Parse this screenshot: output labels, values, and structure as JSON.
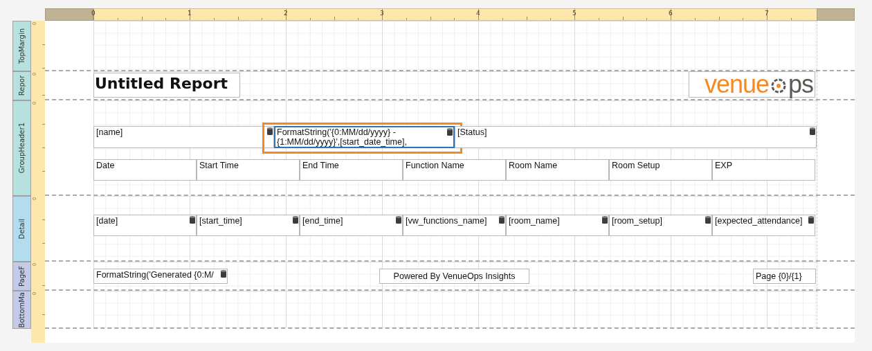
{
  "ruler": {
    "labels": [
      "0",
      "1",
      "2",
      "3",
      "4",
      "5",
      "6",
      "7"
    ]
  },
  "bands": [
    {
      "name": "TopMargin",
      "kind": "margin",
      "ruler_label": "0"
    },
    {
      "name": "Repor",
      "kind": "header",
      "ruler_label": "0",
      "controls": [
        {
          "kind": "title",
          "text": "Untitled Report",
          "bound": false,
          "selected": false
        },
        {
          "kind": "logo",
          "text_1": "venue",
          "text_2": "ps"
        }
      ]
    },
    {
      "name": "GroupHeader1",
      "kind": "header",
      "ruler_label": "0",
      "controls": [
        {
          "kind": "field",
          "text": "[name]",
          "bound": true,
          "selected": false
        },
        {
          "kind": "field",
          "text": "FormatString('{0:MM/dd/yyyy} -\n{1:MM/dd/yyyy}',[start_date_time],",
          "bound": true,
          "selected": true
        },
        {
          "kind": "field",
          "text": "[Status]",
          "bound": true,
          "selected": false
        },
        {
          "kind": "cell",
          "text": "Date",
          "bound": false,
          "selected": false
        },
        {
          "kind": "cell",
          "text": "Start Time",
          "bound": false,
          "selected": false
        },
        {
          "kind": "cell",
          "text": "End Time",
          "bound": false,
          "selected": false
        },
        {
          "kind": "cell",
          "text": "Function Name",
          "bound": false,
          "selected": false
        },
        {
          "kind": "cell",
          "text": "Room Name",
          "bound": false,
          "selected": false
        },
        {
          "kind": "cell",
          "text": "Room Setup",
          "bound": false,
          "selected": false
        },
        {
          "kind": "cell",
          "text": "EXP",
          "bound": false,
          "selected": false
        }
      ]
    },
    {
      "name": "Detail",
      "kind": "detail",
      "ruler_label": "0",
      "controls": [
        {
          "kind": "cell",
          "text": "[date]",
          "bound": true,
          "selected": false
        },
        {
          "kind": "cell",
          "text": "[start_time]",
          "bound": true,
          "selected": false
        },
        {
          "kind": "cell",
          "text": "[end_time]",
          "bound": true,
          "selected": false
        },
        {
          "kind": "cell",
          "text": "[vw_functions_name]",
          "bound": true,
          "selected": false
        },
        {
          "kind": "cell",
          "text": "[room_name]",
          "bound": true,
          "selected": false
        },
        {
          "kind": "cell",
          "text": "[room_setup]",
          "bound": true,
          "selected": false
        },
        {
          "kind": "cell",
          "text": "[expected_attendance]",
          "bound": true,
          "selected": false
        }
      ]
    },
    {
      "name": "PageF",
      "kind": "footer",
      "ruler_label": "0",
      "controls": [
        {
          "kind": "field",
          "text": "FormatString('Generated {0:M/",
          "bound": true,
          "selected": false
        },
        {
          "kind": "field",
          "text": "Powered By VenueOps Insights",
          "bound": false,
          "selected": false
        },
        {
          "kind": "field",
          "text": "Page {0}/{1}",
          "bound": false,
          "selected": false
        }
      ]
    },
    {
      "name": "BottomMa",
      "kind": "footer",
      "ruler_label": "0"
    }
  ]
}
